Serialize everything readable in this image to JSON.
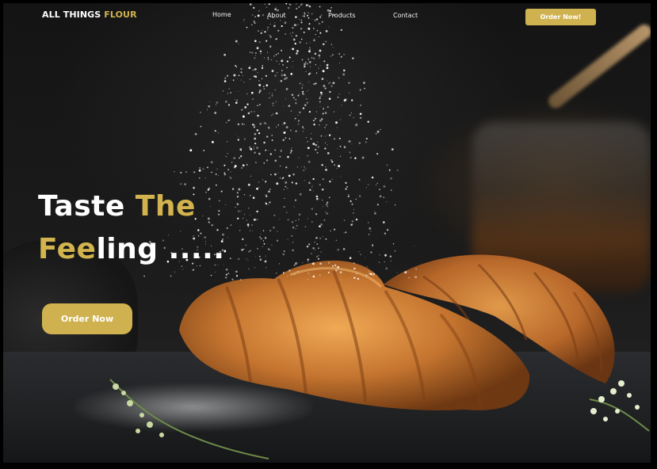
{
  "brand": {
    "logo_part1": "ALL THINGS ",
    "logo_part2": "FLOUR",
    "accent_color": "#d2b34d"
  },
  "nav": {
    "items": [
      {
        "label": "Home"
      },
      {
        "label": "About"
      },
      {
        "label": "Products"
      },
      {
        "label": "Contact"
      }
    ],
    "cta_label": "Order Now!"
  },
  "hero": {
    "line1_white": "Taste ",
    "line1_gold": "The",
    "line2_gold": "Fee",
    "line2_white": "ling .....",
    "cta_label": "Order Now"
  },
  "icons": [
    "flour-dust",
    "croissant-image",
    "honey-jar-image",
    "herb-sprig"
  ]
}
